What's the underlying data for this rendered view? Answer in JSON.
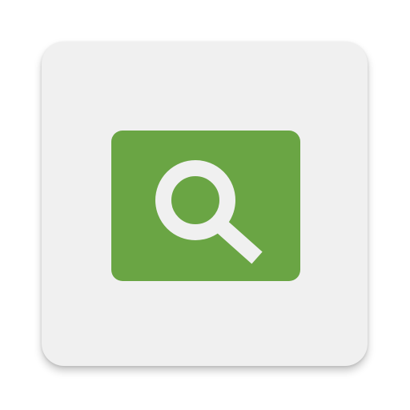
{
  "icon": {
    "name": "search-icon",
    "colors": {
      "page_background": "#ffffff",
      "card_background": "#f0f0f0",
      "tile_background": "#6aa544",
      "glyph": "#f0f0f0"
    }
  }
}
